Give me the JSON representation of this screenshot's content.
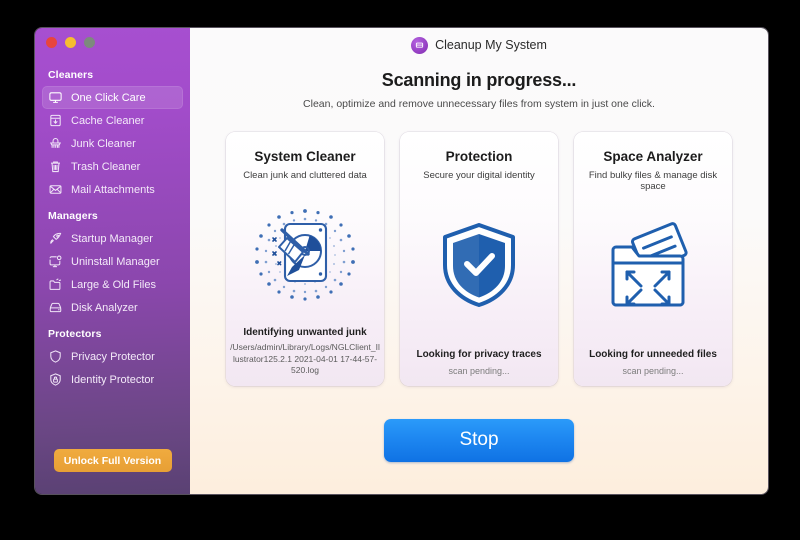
{
  "window": {
    "traffic_lights": [
      {
        "name": "close",
        "color": "#e8453c"
      },
      {
        "name": "minimize",
        "color": "#f6bd30"
      },
      {
        "name": "maximize",
        "color": "#7d8a7d"
      }
    ]
  },
  "app": {
    "title": "Cleanup My System",
    "logo_icon": "app-logo-icon",
    "accent_purple": "#a74fd0",
    "accent_blue": "#1d86f0",
    "accent_orange": "#e79f35"
  },
  "sidebar": {
    "groups": [
      {
        "label": "Cleaners",
        "items": [
          {
            "label": "One Click Care",
            "icon": "monitor-icon",
            "selected": true
          },
          {
            "label": "Cache Cleaner",
            "icon": "cache-box-icon",
            "selected": false
          },
          {
            "label": "Junk Cleaner",
            "icon": "junk-broom-icon",
            "selected": false
          },
          {
            "label": "Trash Cleaner",
            "icon": "trash-icon",
            "selected": false
          },
          {
            "label": "Mail Attachments",
            "icon": "envelope-icon",
            "selected": false
          }
        ]
      },
      {
        "label": "Managers",
        "items": [
          {
            "label": "Startup Manager",
            "icon": "rocket-icon",
            "selected": false
          },
          {
            "label": "Uninstall Manager",
            "icon": "monitor-gear-icon",
            "selected": false
          },
          {
            "label": "Large & Old Files",
            "icon": "folder-icon",
            "selected": false
          },
          {
            "label": "Disk Analyzer",
            "icon": "disk-icon",
            "selected": false
          }
        ]
      },
      {
        "label": "Protectors",
        "items": [
          {
            "label": "Privacy Protector",
            "icon": "shield-icon",
            "selected": false
          },
          {
            "label": "Identity Protector",
            "icon": "lock-icon",
            "selected": false
          }
        ]
      }
    ],
    "unlock_label": "Unlock Full Version"
  },
  "main": {
    "heading": "Scanning in progress...",
    "subheading": "Clean, optimize and remove unnecessary files from system in just one click.",
    "stop_label": "Stop",
    "cards": [
      {
        "title": "System Cleaner",
        "subtitle": "Clean junk and cluttered data",
        "art": "harddrive-broom-icon",
        "status": "Identifying unwanted junk",
        "detail": "/Users/admin/Library/Logs/NGLClient_Illustrator125.2.1 2021-04-01 17-44-57-520.log",
        "detail_pending": false
      },
      {
        "title": "Protection",
        "subtitle": "Secure your digital identity",
        "art": "shield-check-icon",
        "status": "Looking for privacy traces",
        "detail": "scan pending...",
        "detail_pending": true
      },
      {
        "title": "Space Analyzer",
        "subtitle": "Find bulky files & manage disk space",
        "art": "folder-expand-icon",
        "status": "Looking for unneeded files",
        "detail": "scan pending...",
        "detail_pending": true
      }
    ]
  }
}
